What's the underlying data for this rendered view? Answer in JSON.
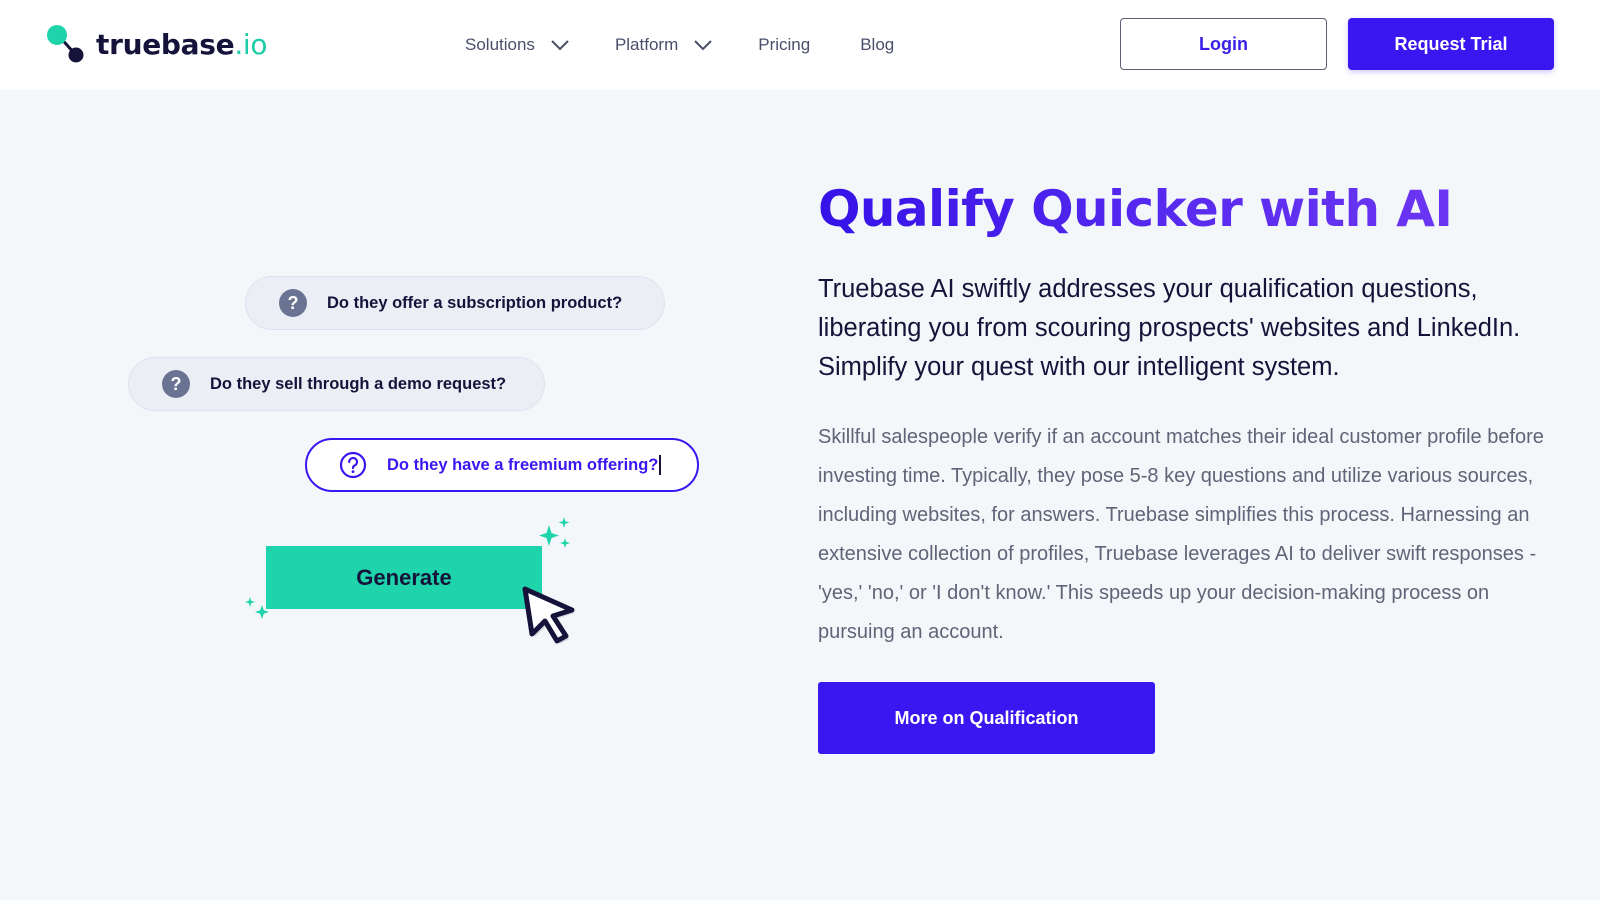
{
  "header": {
    "logo": {
      "name": "truebase",
      "tld": ".io"
    },
    "nav": [
      {
        "label": "Solutions",
        "has_dropdown": true
      },
      {
        "label": "Platform",
        "has_dropdown": true
      },
      {
        "label": "Pricing",
        "has_dropdown": false
      },
      {
        "label": "Blog",
        "has_dropdown": false
      }
    ],
    "login_label": "Login",
    "trial_label": "Request Trial"
  },
  "illustration": {
    "questions": [
      "Do they offer a subscription product?",
      "Do they sell through a demo request?",
      "Do they have a freemium offering?"
    ],
    "question_mark": "?",
    "generate_label": "Generate"
  },
  "main": {
    "headline": "Qualify Quicker with AI",
    "lead": "Truebase AI swiftly addresses your qualification questions, liberating you from scouring prospects' websites and LinkedIn. Simplify your quest with our intelligent system.",
    "body": "Skillful salespeople verify if an account matches their ideal customer profile before investing time. Typically, they pose 5-8 key questions and utilize various sources, including websites, for answers. Truebase simplifies this process. Harnessing an extensive collection of profiles, Truebase leverages AI to deliver swift responses - 'yes,' 'no,' or 'I don't know.' This speeds up your decision-making process on pursuing an account.",
    "cta_label": "More on Qualification"
  },
  "colors": {
    "brand_primary": "#3a17f0",
    "brand_accent": "#1fd3ab",
    "text_dark": "#15133a",
    "text_muted": "#5f6478",
    "page_bg": "#f4f7f9"
  },
  "icons": [
    "logo-mark-icon",
    "chevron-down-icon",
    "question-circle-icon",
    "cursor-arrow-icon",
    "sparkle-icon"
  ]
}
